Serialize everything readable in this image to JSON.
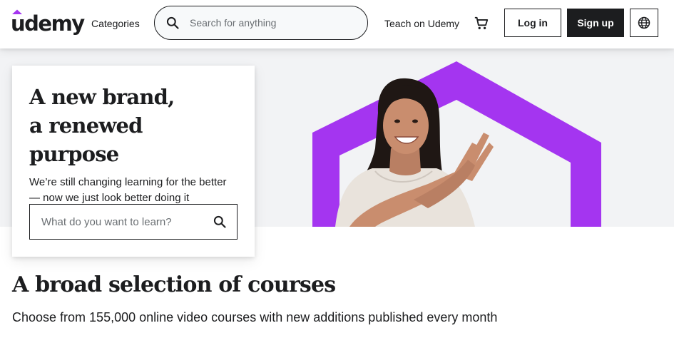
{
  "header": {
    "logo_text": "udemy",
    "categories_label": "Categories",
    "search_placeholder": "Search for anything",
    "teach_label": "Teach on Udemy",
    "login_label": "Log in",
    "signup_label": "Sign up",
    "icons": {
      "search": "search-icon",
      "cart": "cart-icon",
      "language": "globe-icon"
    },
    "brand_color": "#a435f0"
  },
  "hero": {
    "title_line1": "A new brand,",
    "title_line2": "a renewed purpose",
    "subtitle": "We’re still changing learning for the better — now we just look better doing it",
    "search_placeholder": "What do you want to learn?",
    "accent_color": "#a435f0",
    "background_color": "#f2f3f5"
  },
  "courses": {
    "title": "A broad selection of courses",
    "subtitle": "Choose from 155,000 online video courses with new additions published every month"
  }
}
